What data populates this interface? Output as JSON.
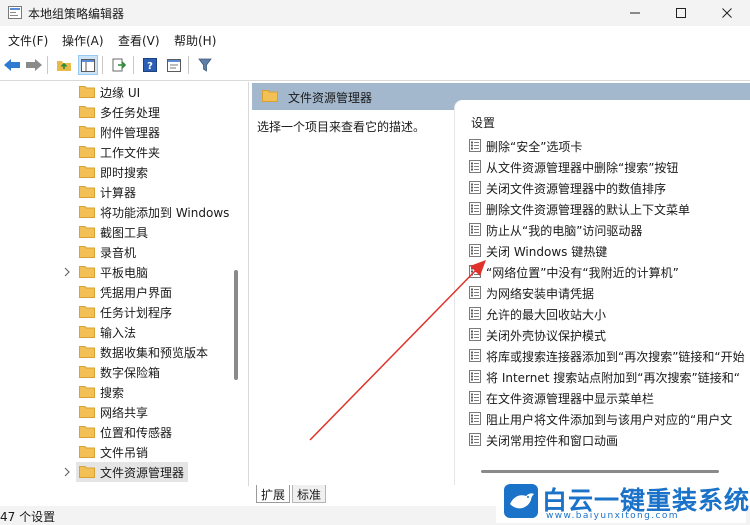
{
  "window": {
    "title": "本地组策略编辑器"
  },
  "menu": {
    "items": [
      "文件(F)",
      "操作(A)",
      "查看(V)",
      "帮助(H)"
    ]
  },
  "toolbar": {
    "icons": [
      "back-icon",
      "forward-icon",
      "up-folder-icon",
      "show-tree-icon",
      "export-icon",
      "help-icon",
      "properties-icon",
      "filter-icon"
    ]
  },
  "tree": {
    "items": [
      {
        "label": "边缘 UI",
        "expandable": false,
        "selected": false
      },
      {
        "label": "多任务处理",
        "expandable": false,
        "selected": false
      },
      {
        "label": "附件管理器",
        "expandable": false,
        "selected": false
      },
      {
        "label": "工作文件夹",
        "expandable": false,
        "selected": false
      },
      {
        "label": "即时搜索",
        "expandable": false,
        "selected": false
      },
      {
        "label": "计算器",
        "expandable": false,
        "selected": false
      },
      {
        "label": "将功能添加到 Windows",
        "expandable": false,
        "selected": false
      },
      {
        "label": "截图工具",
        "expandable": false,
        "selected": false
      },
      {
        "label": "录音机",
        "expandable": false,
        "selected": false
      },
      {
        "label": "平板电脑",
        "expandable": true,
        "selected": false
      },
      {
        "label": "凭据用户界面",
        "expandable": false,
        "selected": false
      },
      {
        "label": "任务计划程序",
        "expandable": false,
        "selected": false
      },
      {
        "label": "输入法",
        "expandable": false,
        "selected": false
      },
      {
        "label": "数据收集和预览版本",
        "expandable": false,
        "selected": false
      },
      {
        "label": "数字保险箱",
        "expandable": false,
        "selected": false
      },
      {
        "label": "搜索",
        "expandable": false,
        "selected": false
      },
      {
        "label": "网络共享",
        "expandable": false,
        "selected": false
      },
      {
        "label": "位置和传感器",
        "expandable": false,
        "selected": false
      },
      {
        "label": "文件吊销",
        "expandable": false,
        "selected": false
      },
      {
        "label": "文件资源管理器",
        "expandable": true,
        "selected": true
      }
    ]
  },
  "right": {
    "header": "文件资源管理器",
    "description": "选择一个项目来查看它的描述。",
    "column_header": "设置",
    "settings": [
      "删除“安全”选项卡",
      "从文件资源管理器中删除“搜索”按钮",
      "关闭文件资源管理器中的数值排序",
      "删除文件资源管理器的默认上下文菜单",
      "防止从“我的电脑”访问驱动器",
      "关闭 Windows 键热键",
      "“网络位置”中没有“我附近的计算机”",
      "为网络安装申请凭据",
      "允许的最大回收站大小",
      "关闭外壳协议保护模式",
      "将库或搜索连接器添加到“再次搜索”链接和“开始",
      "将 Internet 搜索站点附加到“再次搜索”链接和“",
      "在文件资源管理器中显示菜单栏",
      "阻止用户将文件添加到与该用户对应的“用户文",
      "关闭常用控件和窗口动画"
    ]
  },
  "tabs": {
    "extended": "扩展",
    "standard": "标准"
  },
  "status": {
    "text": "47 个设置"
  },
  "watermark": {
    "title": "白云一键重装系统",
    "url": "www.baiyunxitong.com"
  },
  "colors": {
    "header_bg": "#a3b7cd",
    "folder": "#f2c055",
    "accent_arrow": "#e0312b",
    "watermark": "#1a72c9"
  }
}
